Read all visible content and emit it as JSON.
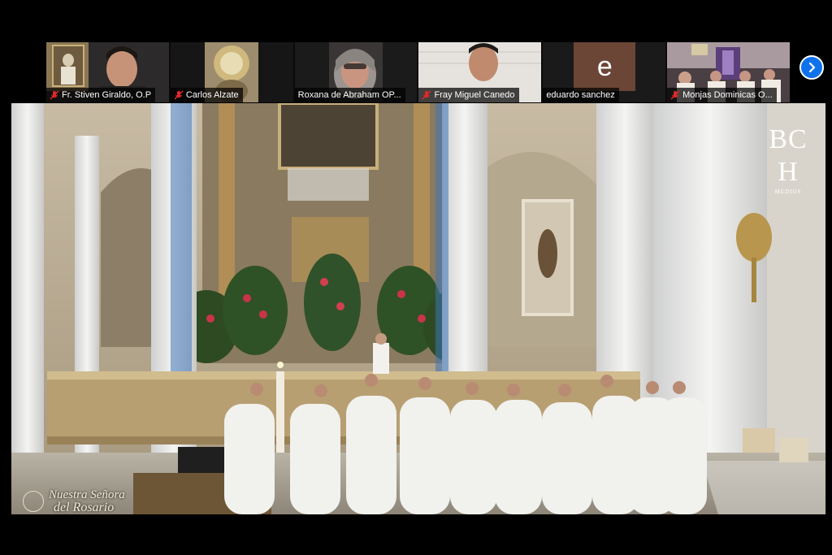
{
  "meeting": {
    "participants": [
      {
        "name": "Fr. Stiven Giraldo, O.P",
        "muted": true,
        "active": false
      },
      {
        "name": "Carlos Alzate",
        "muted": true,
        "active": false
      },
      {
        "name": "Roxana de Abraham OP...",
        "muted": false,
        "active": true
      },
      {
        "name": "Fray Miguel Canedo",
        "muted": true,
        "active": false
      },
      {
        "name": "eduardo sanchez",
        "muted": false,
        "active": false,
        "avatar_letter": "e"
      },
      {
        "name": "Monjas Dominicas O...",
        "muted": true,
        "active": false
      }
    ],
    "next_page_icon": "chevron-right-icon",
    "colors": {
      "active_border": "#8fcf46",
      "muted_icon": "#e02828",
      "nav_button": "#0e72ed",
      "avatar_bg": "#6b4536"
    }
  },
  "video": {
    "watermark": {
      "text": "BC H",
      "sub": "MEDIOS"
    },
    "caption": {
      "line1": "Nuestra Señora",
      "line2": "del Rosario"
    }
  }
}
